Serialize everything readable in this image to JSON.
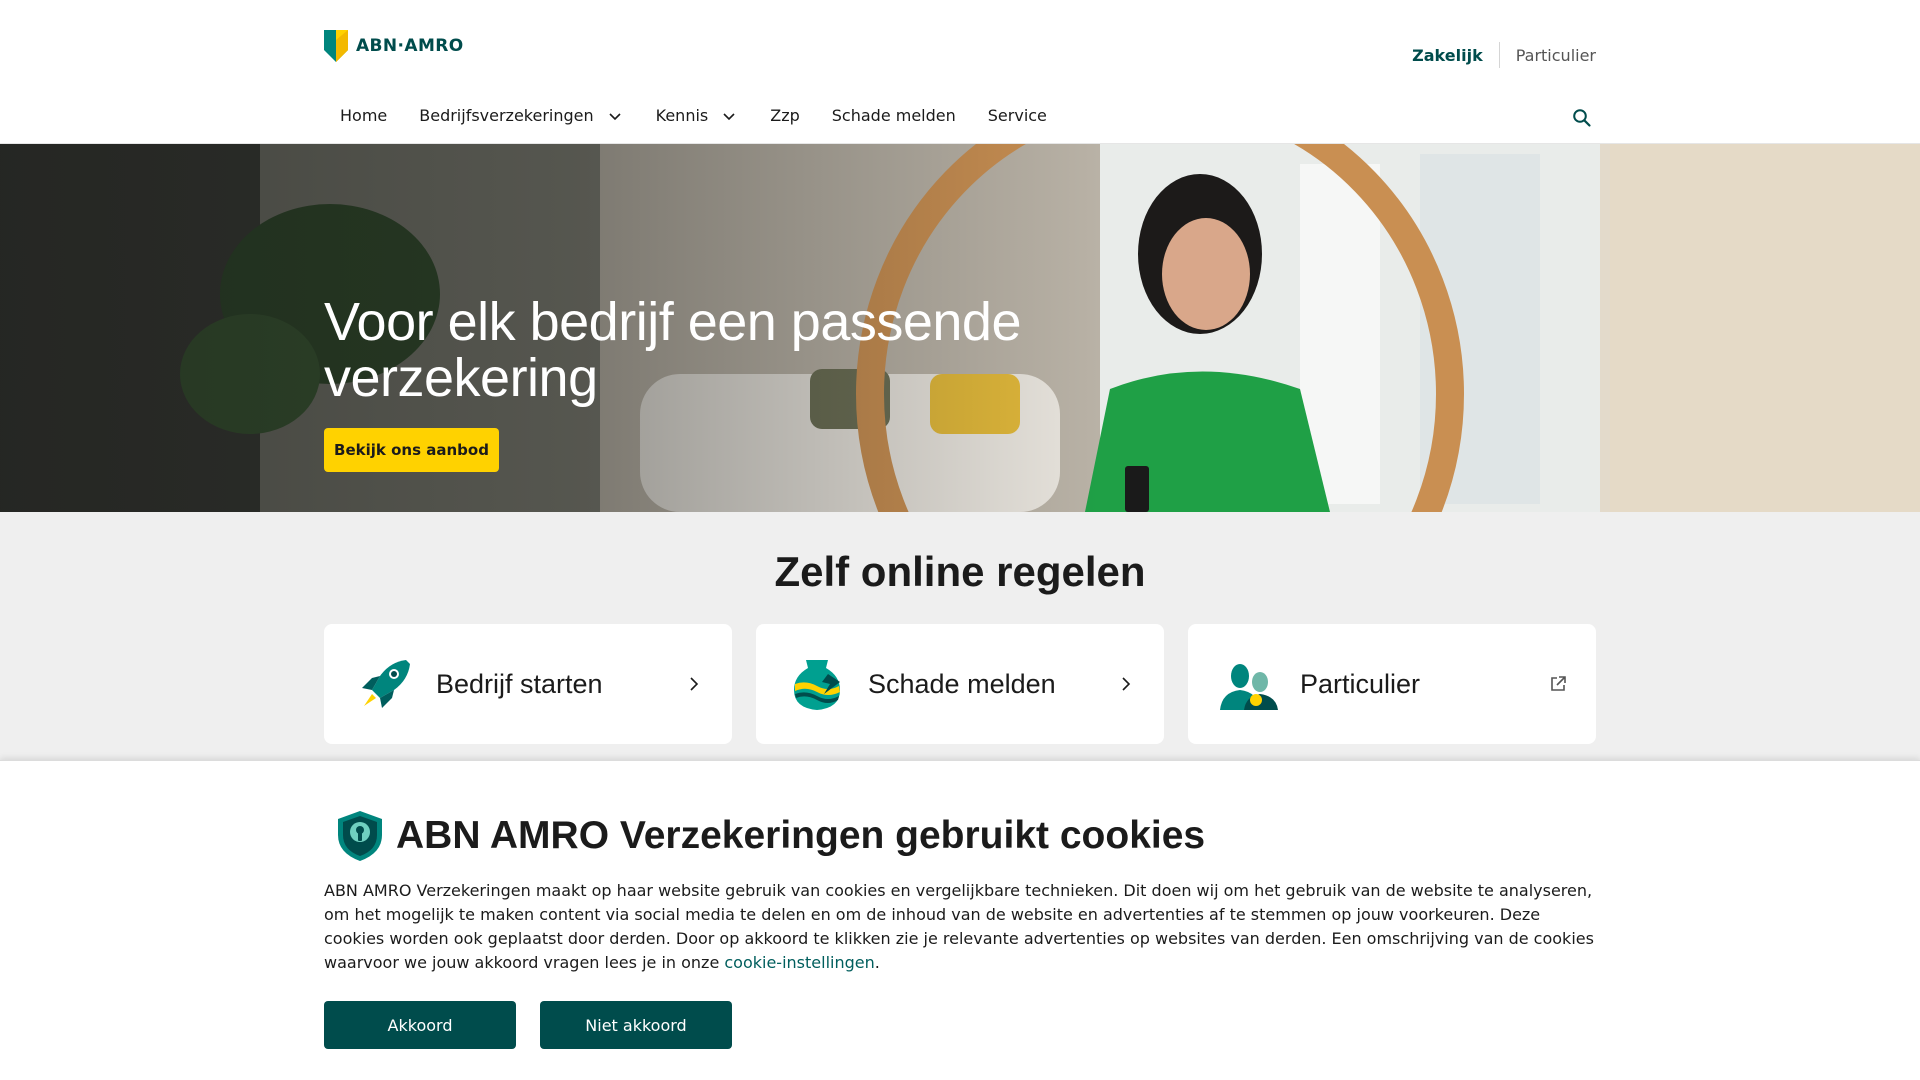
{
  "brand": {
    "name": "ABN·AMRO",
    "accent": "#004c4c",
    "yellow": "#ffd200",
    "green_light": "#00a090"
  },
  "segments": {
    "zakelijk": "Zakelijk",
    "particulier": "Particulier"
  },
  "nav": {
    "items": [
      {
        "label": "Home",
        "has_dropdown": false
      },
      {
        "label": "Bedrijfsverzekeringen",
        "has_dropdown": true
      },
      {
        "label": "Kennis",
        "has_dropdown": true
      },
      {
        "label": "Zzp",
        "has_dropdown": false
      },
      {
        "label": "Schade melden",
        "has_dropdown": false
      },
      {
        "label": "Service",
        "has_dropdown": false
      }
    ],
    "search_icon": "search-icon"
  },
  "hero": {
    "title": "Voor elk bedrijf een passende verzekering",
    "cta_label": "Bekijk ons aanbod"
  },
  "online": {
    "title": "Zelf online regelen",
    "cards": [
      {
        "label": "Bedrijf starten",
        "icon": "rocket-icon",
        "arrow": "chevron-right-icon"
      },
      {
        "label": "Schade melden",
        "icon": "broken-vase-icon",
        "arrow": "chevron-right-icon"
      },
      {
        "label": "Particulier",
        "icon": "people-icon",
        "arrow": "external-link-icon"
      }
    ]
  },
  "cookie": {
    "title": "ABN AMRO Verzekeringen gebruikt cookies",
    "text": "ABN AMRO Verzekeringen maakt op haar website gebruik van cookies en vergelijkbare technieken. Dit doen wij om het gebruik van de website te analyseren, om het mogelijk te maken content via social media te delen en om de inhoud van de website en advertenties af te stemmen op jouw voorkeuren. Deze cookies worden ook geplaatst door derden. Door op akkoord te klikken zie je relevante advertenties op websites van derden. Een omschrijving van de cookies waarvoor we jouw akkoord vragen lees je in onze",
    "link_label": "cookie-instellingen",
    "accept_label": "Akkoord",
    "decline_label": "Niet akkoord"
  }
}
